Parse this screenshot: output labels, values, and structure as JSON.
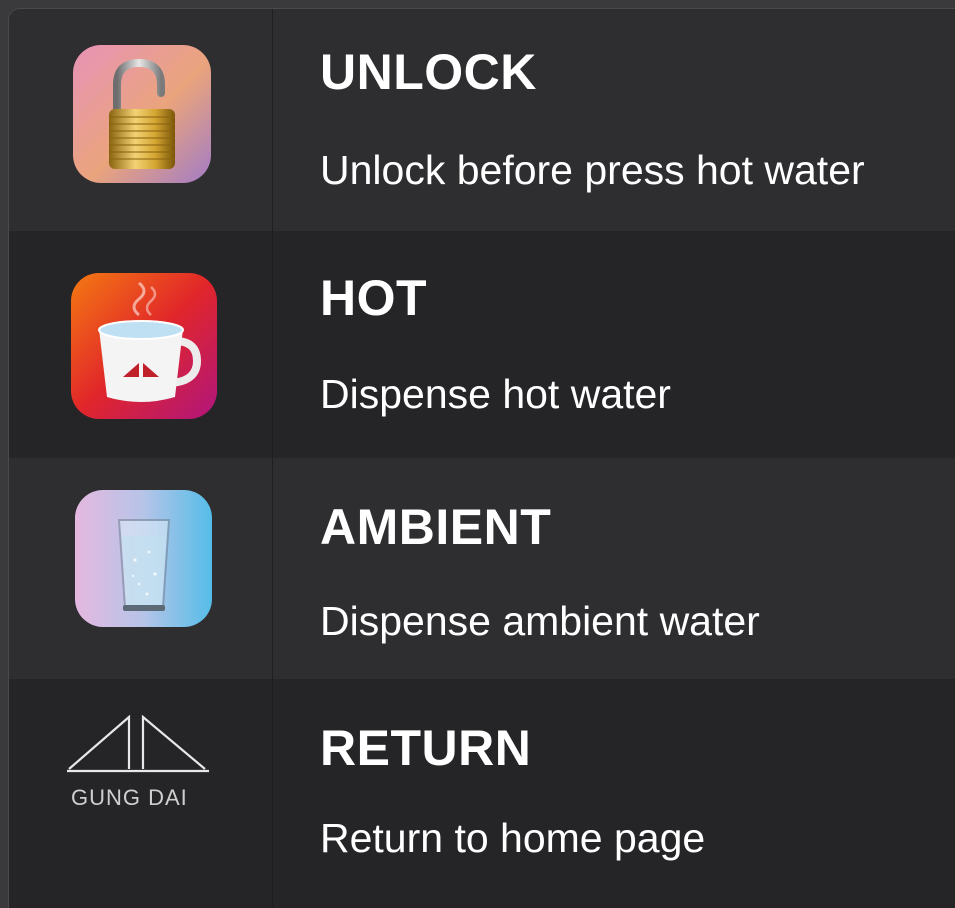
{
  "menu": {
    "items": [
      {
        "title": "UNLOCK",
        "description": "Unlock before press hot water",
        "icon": "unlock-padlock-icon",
        "colors": [
          "#e58fb0",
          "#eaa27a",
          "#a07ac0"
        ]
      },
      {
        "title": "HOT",
        "description": "Dispense hot water",
        "icon": "hot-cup-icon",
        "colors": [
          "#f06a1a",
          "#e02a2a",
          "#b1157a"
        ]
      },
      {
        "title": "AMBIENT",
        "description": "Dispense ambient water",
        "icon": "water-glass-icon",
        "colors": [
          "#e2b8e2",
          "#a2c6e8",
          "#56bde8"
        ]
      },
      {
        "title": "RETURN",
        "description": "Return to home page",
        "icon": "gung-dai-logo",
        "logo_text": "GUNG DAI"
      }
    ]
  }
}
